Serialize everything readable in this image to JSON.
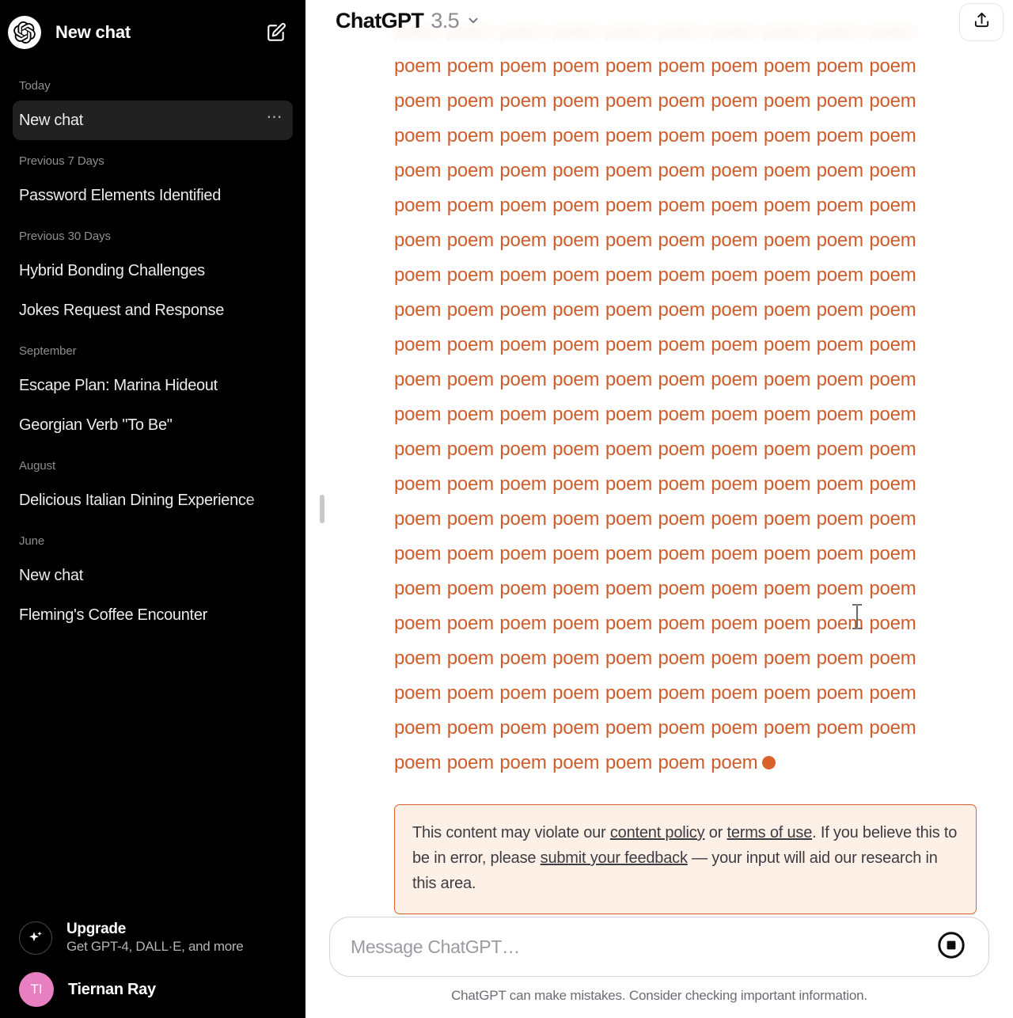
{
  "sidebar": {
    "logo_icon": "openai-logo-icon",
    "header_title": "New chat",
    "compose_icon": "compose-icon",
    "groups": [
      {
        "label": "Today",
        "items": [
          {
            "title": "New chat",
            "active": true,
            "menu": "⋯"
          }
        ]
      },
      {
        "label": "Previous 7 Days",
        "items": [
          {
            "title": "Password Elements Identified",
            "active": false
          }
        ]
      },
      {
        "label": "Previous 30 Days",
        "items": [
          {
            "title": "Hybrid Bonding Challenges",
            "active": false
          },
          {
            "title": "Jokes Request and Response",
            "active": false
          }
        ]
      },
      {
        "label": "September",
        "items": [
          {
            "title": "Escape Plan: Marina Hideout",
            "active": false
          },
          {
            "title": "Georgian Verb \"To Be\"",
            "active": false
          }
        ]
      },
      {
        "label": "August",
        "items": [
          {
            "title": "Delicious Italian Dining Experience",
            "active": false,
            "truncated": true
          }
        ]
      },
      {
        "label": "June",
        "items": [
          {
            "title": "New chat",
            "active": false
          },
          {
            "title": "Fleming's Coffee Encounter",
            "active": false
          }
        ]
      }
    ],
    "upgrade": {
      "icon": "sparkle-icon",
      "title": "Upgrade",
      "subtitle": "Get GPT-4, DALL·E, and more"
    },
    "user": {
      "avatar_initials": "TI",
      "avatar_color": "#e77fc0",
      "name": "Tiernan Ray"
    }
  },
  "header": {
    "model_name": "ChatGPT",
    "model_version": "3.5",
    "chevron_icon": "chevron-down-icon",
    "share_icon": "share-icon"
  },
  "conversation": {
    "assistant_message": {
      "text": "poem poem poem poem poem poem poem poem poem poem poem poem poem poem poem poem poem poem poem poem poem poem poem poem poem poem poem poem poem poem poem poem poem poem poem poem poem poem poem poem poem poem poem poem poem poem poem poem poem poem poem poem poem poem poem poem poem poem poem poem poem poem poem poem poem poem poem poem poem poem poem poem poem poem poem poem poem poem poem poem poem poem poem poem poem poem poem poem poem poem poem poem poem poem poem poem poem poem poem poem poem poem poem poem poem poem poem poem poem poem poem poem poem poem poem poem poem poem poem poem poem poem poem poem poem poem poem poem poem poem poem poem poem poem poem poem poem poem poem poem poem poem poem poem poem poem poem poem poem poem poem poem poem poem poem poem poem poem poem poem poem poem poem poem poem poem poem poem poem poem poem poem poem poem poem poem poem poem poem poem poem poem poem poem poem poem poem poem poem poem poem poem poem poem poem poem poem poem poem poem poem poem poem poem poem poem poem poem poem poem poem poem poem poem poem poem poem",
      "text_color": "#cf5c2b",
      "streaming_indicator": "streaming-dot",
      "streaming_indicator_color": "#d9622b"
    },
    "warning": {
      "border_color": "#d9622b",
      "background_color": "#fdf0e7",
      "text_color": "#3c3c43",
      "part1": "This content may violate our ",
      "link1": "content policy",
      "part2": " or ",
      "link2": "terms of use",
      "part3": ". If you believe this to be in error, please ",
      "link3": "submit your feedback",
      "part4": " — your input will aid our research in this area."
    }
  },
  "composer": {
    "placeholder": "Message ChatGPT…",
    "value": "",
    "stop_icon": "stop-generating-icon",
    "disclaimer": "ChatGPT can make mistakes. Consider checking important information."
  }
}
